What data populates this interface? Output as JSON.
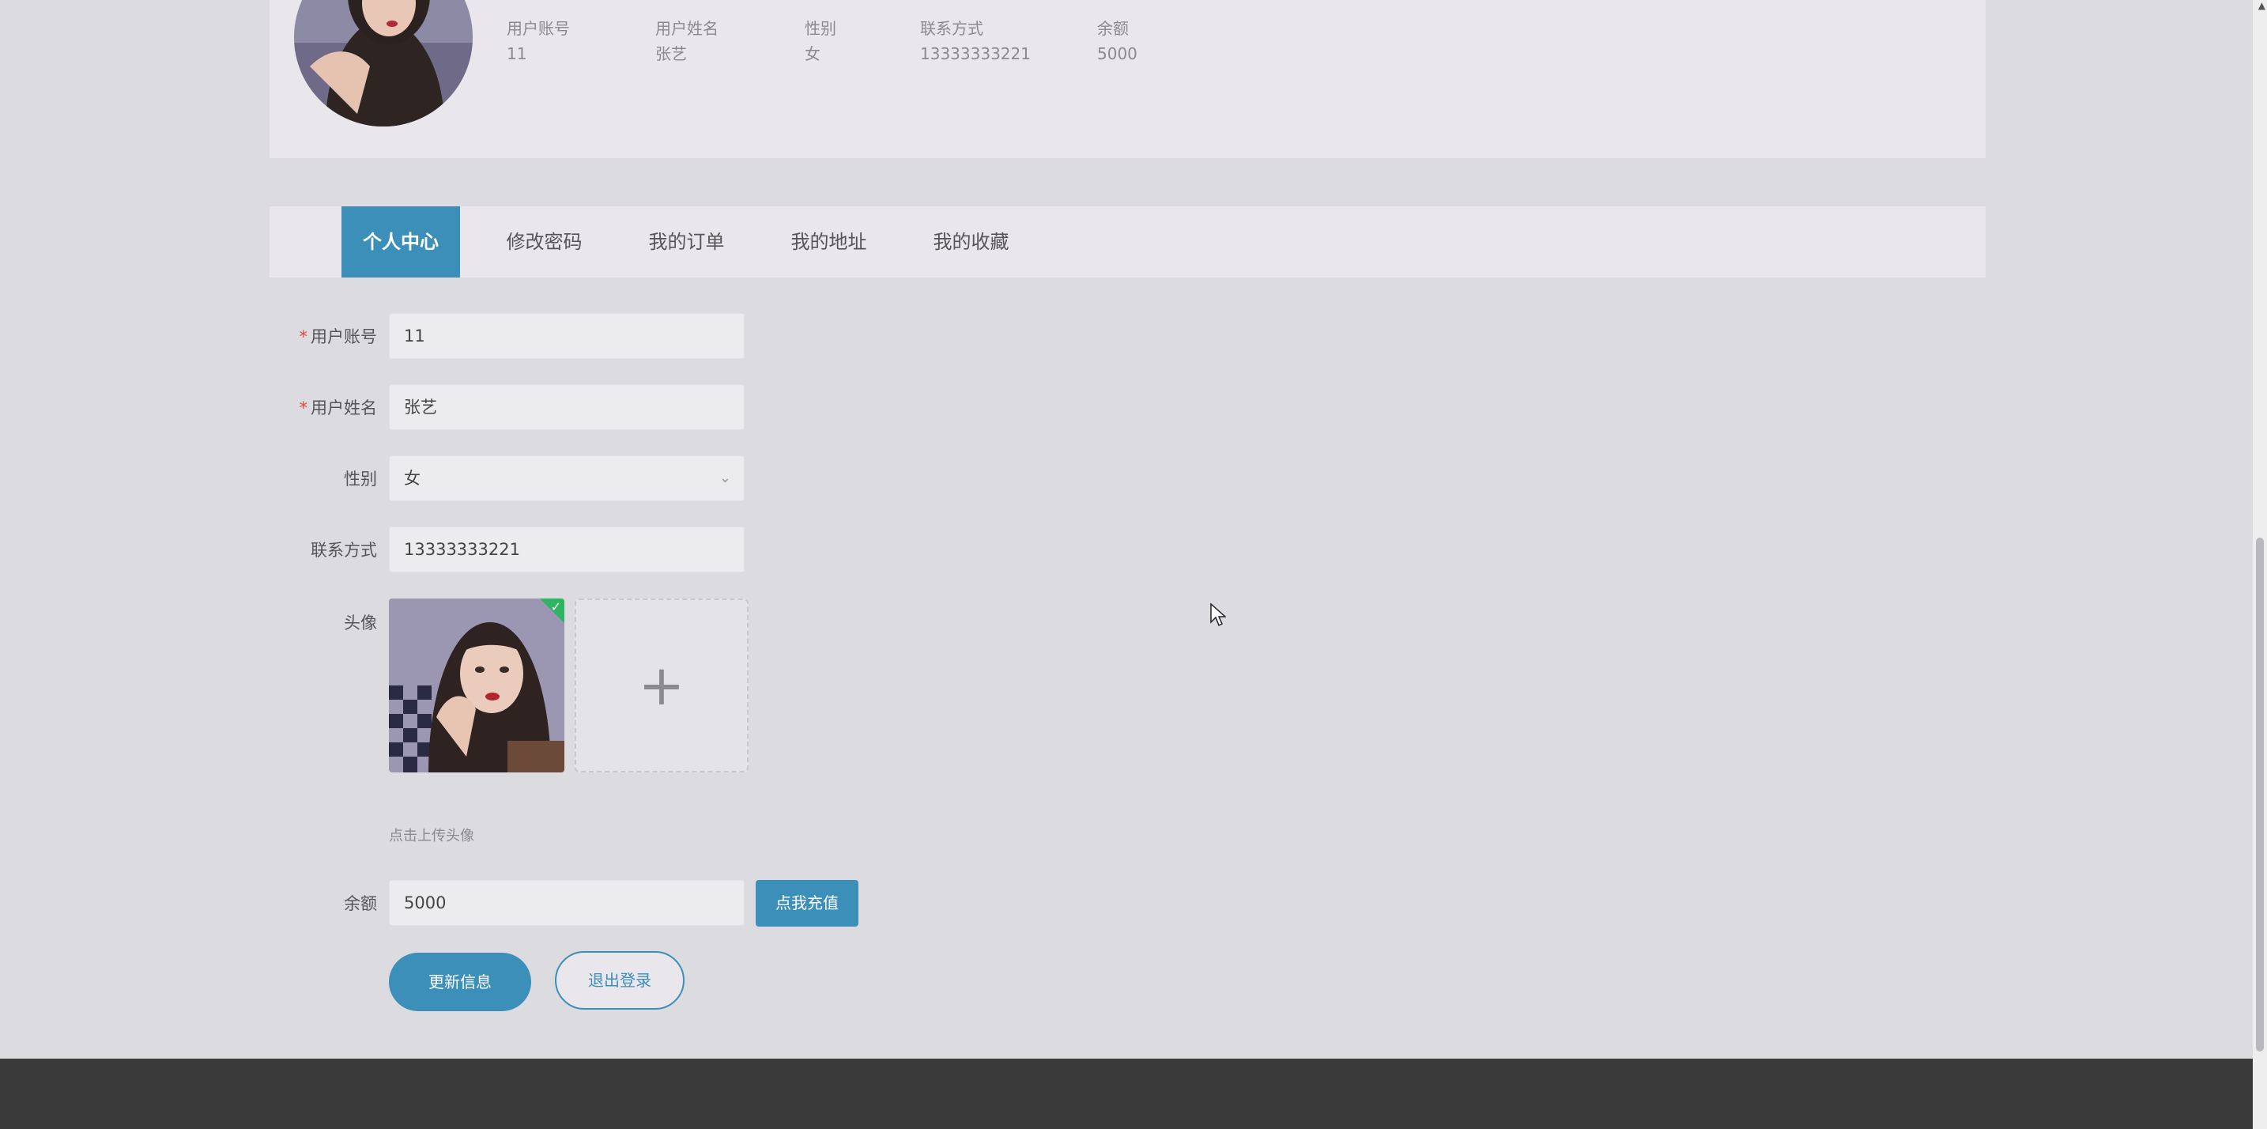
{
  "profile": {
    "columns": [
      {
        "label": "用户账号",
        "value": "11"
      },
      {
        "label": "用户姓名",
        "value": "张艺"
      },
      {
        "label": "性别",
        "value": "女"
      },
      {
        "label": "联系方式",
        "value": "13333333221"
      },
      {
        "label": "余额",
        "value": "5000"
      }
    ]
  },
  "tabs": [
    {
      "label": "个人中心",
      "active": true
    },
    {
      "label": "修改密码"
    },
    {
      "label": "我的订单"
    },
    {
      "label": "我的地址"
    },
    {
      "label": "我的收藏"
    }
  ],
  "form": {
    "account": {
      "label": "用户账号",
      "value": "11",
      "required": "*"
    },
    "name": {
      "label": "用户姓名",
      "value": "张艺",
      "required": "*"
    },
    "gender": {
      "label": "性别",
      "value": "女"
    },
    "phone": {
      "label": "联系方式",
      "value": "13333333221"
    },
    "avatar": {
      "label": "头像",
      "hint": "点击上传头像"
    },
    "balance": {
      "label": "余额",
      "value": "5000",
      "recharge_label": "点我充值"
    },
    "update_label": "更新信息",
    "logout_label": "退出登录"
  },
  "colors": {
    "accent": "#3c8fb9",
    "success": "#2fb463",
    "required": "#e8453c",
    "footer": "#3a3a3a"
  }
}
